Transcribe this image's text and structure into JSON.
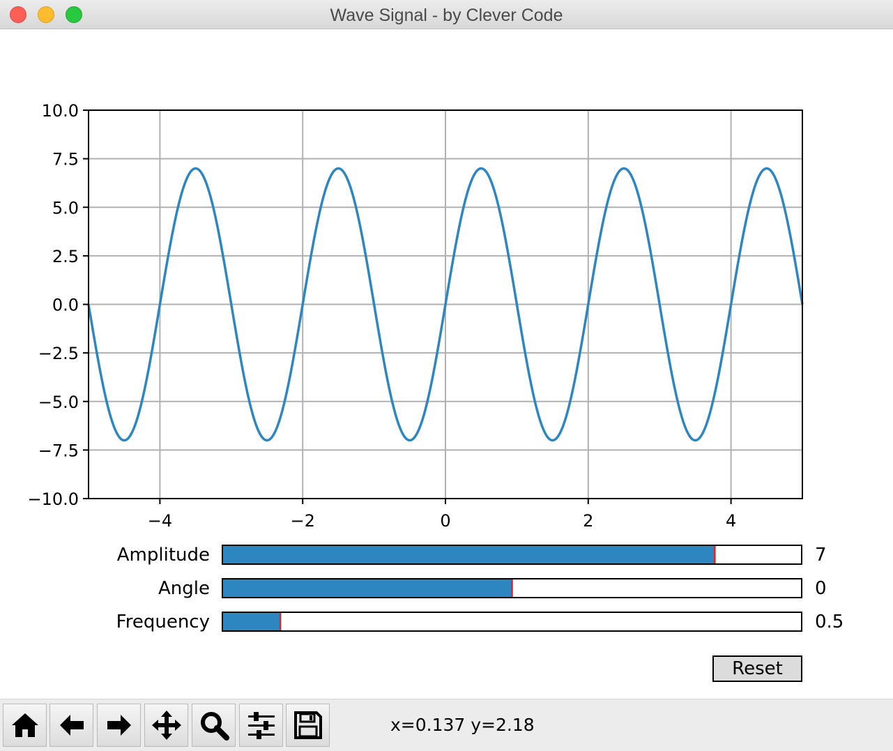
{
  "window": {
    "title": "Wave Signal - by Clever Code"
  },
  "chart_data": {
    "type": "line",
    "title": "",
    "xlabel": "",
    "ylabel": "",
    "xlim": [
      -5,
      5
    ],
    "ylim": [
      -10,
      10
    ],
    "x_ticks": [
      "−4",
      "−2",
      "0",
      "2",
      "4"
    ],
    "y_ticks": [
      "10.0",
      "7.5",
      "5.0",
      "2.5",
      "0.0",
      "−2.5",
      "−5.0",
      "−7.5",
      "−10.0"
    ],
    "grid": true,
    "series": [
      {
        "function": "amplitude * sin(2*pi*frequency*x + angle)",
        "amplitude": 7,
        "frequency": 0.5,
        "angle": 0,
        "color": "#2e86c1"
      }
    ]
  },
  "sliders": [
    {
      "label": "Amplitude",
      "value_text": "7",
      "fill_fraction": 0.85
    },
    {
      "label": "Angle",
      "value_text": "0",
      "fill_fraction": 0.5
    },
    {
      "label": "Frequency",
      "value_text": "0.5",
      "fill_fraction": 0.1
    }
  ],
  "reset_button": {
    "label": "Reset"
  },
  "toolbar": {
    "tools": [
      "home-icon",
      "back-arrow-icon",
      "forward-arrow-icon",
      "pan-move-icon",
      "zoom-magnifier-icon",
      "configure-subplots-icon",
      "save-floppy-icon"
    ],
    "coordinates": "x=0.137 y=2.18"
  },
  "colors": {
    "line": "#2e86c1",
    "slider_fill": "#2e86c1",
    "slider_marker": "#d62728",
    "grid": "#b0b0b0"
  }
}
